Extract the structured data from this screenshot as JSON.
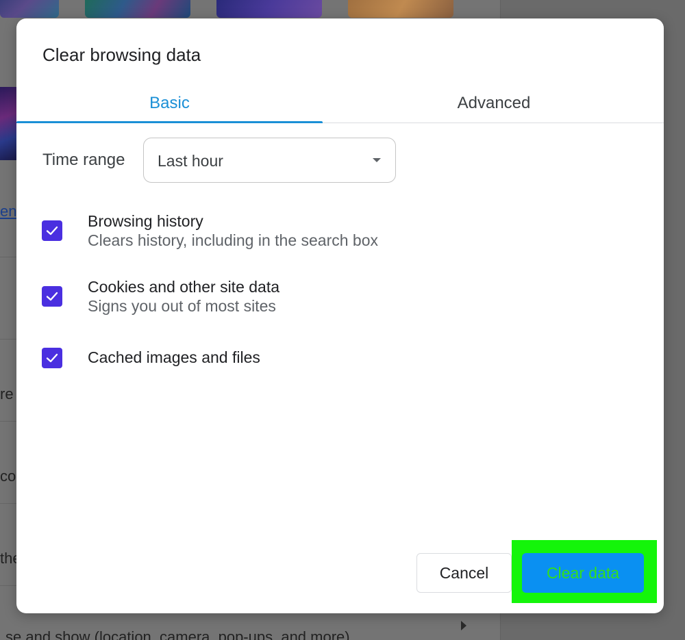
{
  "background": {
    "side_texts": [
      "en",
      "re",
      "cog",
      "the"
    ],
    "bottom_text": "se and show (location, camera, pop-ups, and more)"
  },
  "dialog": {
    "title": "Clear browsing data",
    "tabs": [
      {
        "label": "Basic",
        "selected": true
      },
      {
        "label": "Advanced",
        "selected": false
      }
    ],
    "time_range": {
      "label": "Time range",
      "selected": "Last hour"
    },
    "options": [
      {
        "title": "Browsing history",
        "subtitle": "Clears history, including in the search box",
        "checked": true
      },
      {
        "title": "Cookies and other site data",
        "subtitle": "Signs you out of most sites",
        "checked": true
      },
      {
        "title": "Cached images and files",
        "subtitle": "",
        "checked": true
      }
    ],
    "buttons": {
      "cancel": "Cancel",
      "clear": "Clear data"
    }
  },
  "colors": {
    "accent": "#1a8fd6",
    "checkbox": "#4a2fe0",
    "primary_button": "#0a90f2",
    "highlight": "#14f50a"
  }
}
